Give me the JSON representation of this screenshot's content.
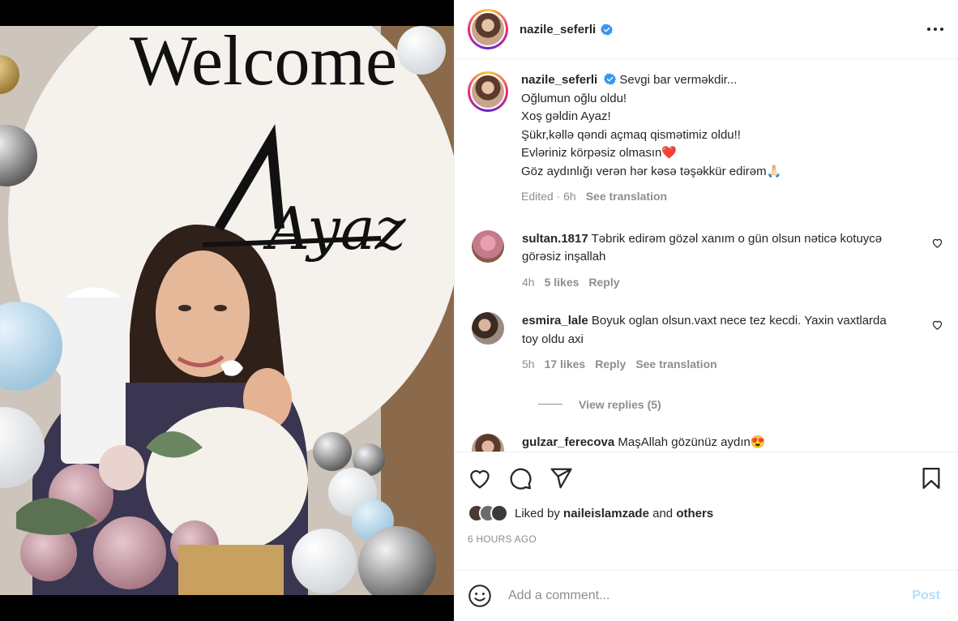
{
  "post": {
    "author": "nazile_seferli",
    "image_text": {
      "welcome": "Welcome",
      "name": "Ayaz"
    },
    "caption_lines": [
      "Sevgi bar verməkdir...",
      "Oğlumun oğlu oldu!",
      "Xoş gəldin Ayaz!",
      "Şükr,kəllə qəndi açmaq qismətimiz oldu!!",
      "Evləriniz körpəsiz olmasın❤️",
      "Göz aydınlığı verən hər kəsə təşəkkür edirəm🙏🏻"
    ],
    "caption_meta": {
      "edited": "Edited · 6h",
      "translate": "See translation"
    }
  },
  "comments": [
    {
      "user": "sultan.1817",
      "text": "Təbrik edirəm gözəl xanım o gün olsun nəticə kotuycə görəsiz inşallah",
      "time": "4h",
      "likes": "5 likes",
      "reply": "Reply",
      "translate": ""
    },
    {
      "user": "esmira_lale",
      "text": "Boyuk oglan olsun.vaxt nece tez kecdi. Yaxin vaxtlarda toy oldu axi",
      "time": "5h",
      "likes": "17 likes",
      "reply": "Reply",
      "translate": "See translation"
    },
    {
      "user": "gulzar_ferecova",
      "text": "MaşAllah gözünüz aydın😍"
    }
  ],
  "view_replies": "View replies (5)",
  "likes": {
    "prefix": "Liked by",
    "user": "naileislamzade",
    "and": "and",
    "others": "others"
  },
  "timestamp": "6 HOURS AGO",
  "add_comment": {
    "placeholder": "Add a comment...",
    "post_label": "Post"
  },
  "colors": {
    "accent": "#0095f6",
    "post_disabled": "#b2dffc",
    "verified": "#3897f0",
    "heart_red": "#ed4956"
  },
  "icons": [
    "heart-icon",
    "comment-icon",
    "share-icon",
    "bookmark-icon",
    "emoji-icon",
    "more-icon",
    "verified-icon"
  ]
}
